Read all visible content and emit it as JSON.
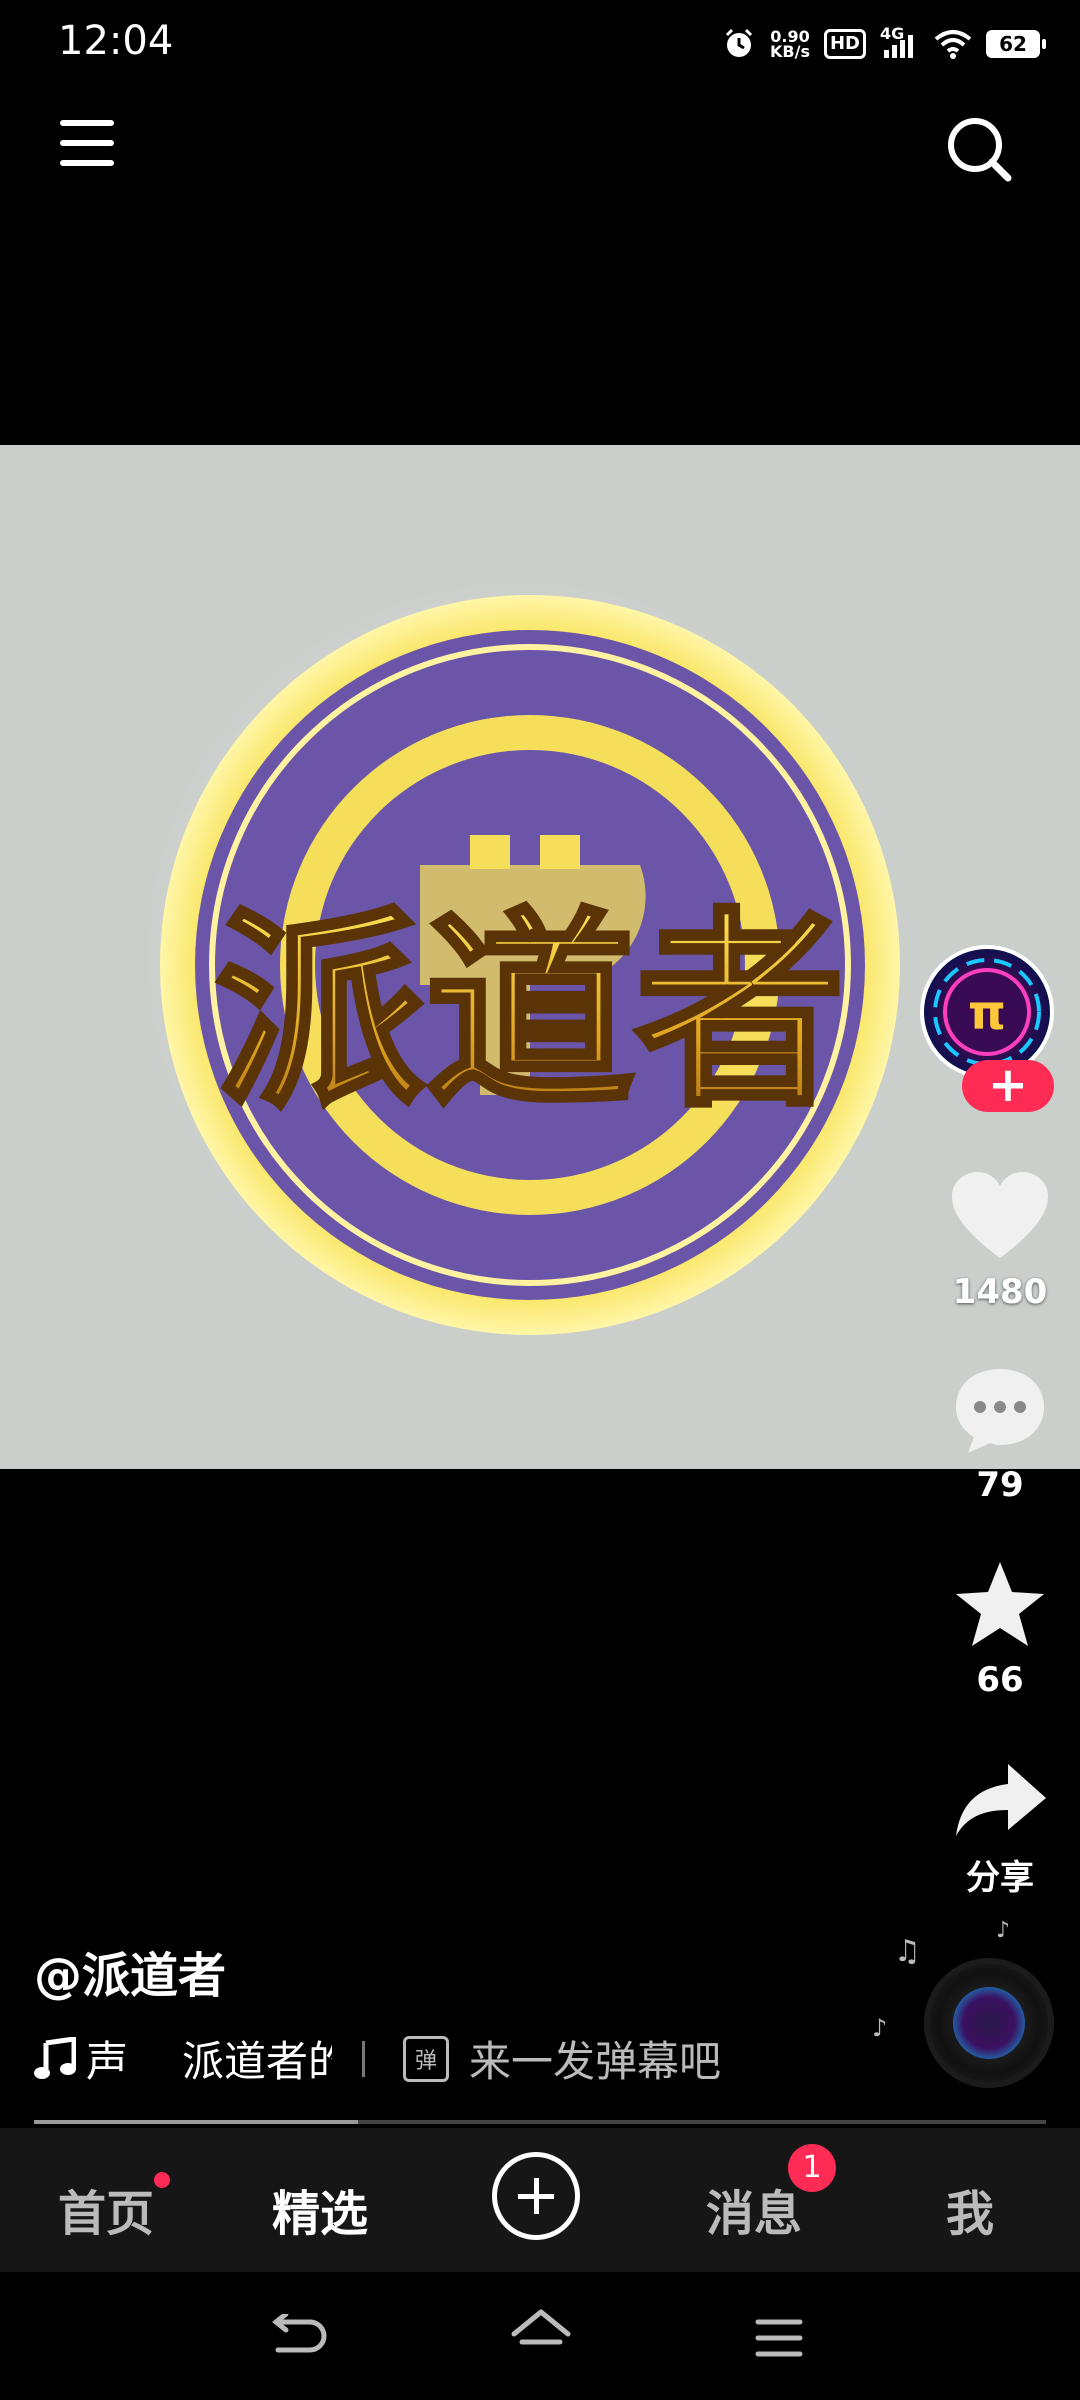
{
  "status_bar": {
    "time": "12:04",
    "net_speed_value": "0.90",
    "net_speed_unit": "KB/s",
    "hd": "HD",
    "network": "4G",
    "battery": "62",
    "icons": [
      "alarm-icon",
      "hd-badge",
      "signal-icon",
      "wifi-icon",
      "battery-icon"
    ]
  },
  "top_bar": {
    "icons": [
      "menu-icon",
      "search-icon"
    ]
  },
  "video": {
    "logo_text": "派道者",
    "background": "#cbcfcc"
  },
  "right_rail": {
    "likes": "1480",
    "comments": "79",
    "favorites": "66",
    "share_label": "分享",
    "icons": [
      "creator-avatar",
      "follow-plus-icon",
      "heart-icon",
      "comment-icon",
      "star-icon",
      "share-icon",
      "music-disc"
    ]
  },
  "info": {
    "username": "@派道者",
    "music_prefix": "声",
    "music_track": "派道者的",
    "danmaku_icon_text": "弹",
    "danmaku_placeholder": "来一发弹幕吧"
  },
  "progress": {
    "fraction": 0.32
  },
  "bottom_nav": {
    "items": [
      {
        "label": "首页",
        "has_dot": true
      },
      {
        "label": "精选",
        "active": true
      },
      {
        "label": ""
      },
      {
        "label": "消息",
        "badge": "1"
      },
      {
        "label": "我"
      }
    ]
  },
  "system_nav": {
    "icons": [
      "back-icon",
      "home-icon",
      "recents-icon"
    ]
  },
  "colors": {
    "accent": "#fe2c55",
    "gold": "#f5d53a",
    "purple": "#6a55a8"
  }
}
